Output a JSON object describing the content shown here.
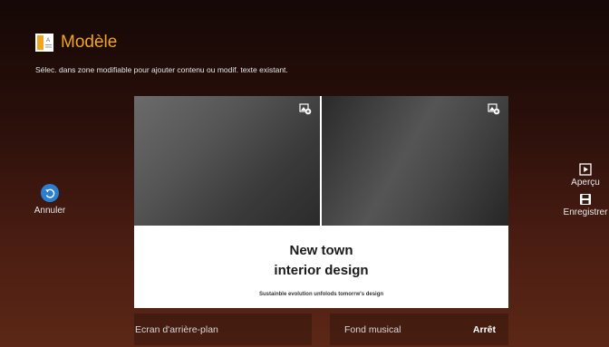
{
  "header": {
    "title": "Modèle",
    "subtitle": "Sélec. dans zone modifiable pour ajouter contenu ou modif. texte existant."
  },
  "template": {
    "headline_line1": "New town",
    "headline_line2": "interior design",
    "tagline": "Sustainble evolution unfolods tomorrw's design"
  },
  "actions": {
    "undo_label": "Annuler",
    "preview_label": "Aperçu",
    "save_label": "Enregistrer"
  },
  "footer": {
    "background_label": "Ecran d'arrière-plan",
    "music_label": "Fond musical",
    "music_value": "Arrêt"
  },
  "colors": {
    "accent": "#f0a521",
    "undo_button": "#2a7fd0"
  },
  "icons": {
    "template": "template-icon",
    "image_edit": "image-edit-icon",
    "undo": "undo-icon",
    "preview": "play-icon",
    "save": "save-icon"
  }
}
